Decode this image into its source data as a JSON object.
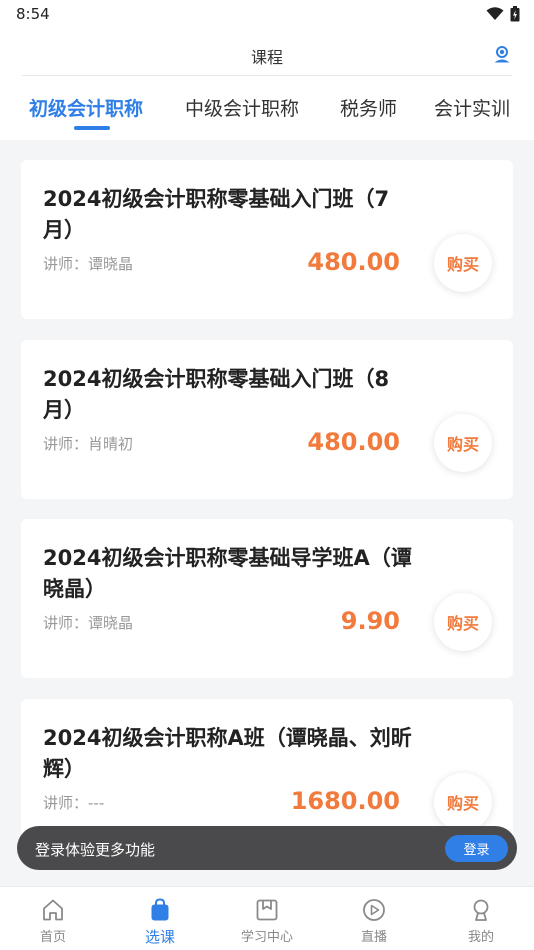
{
  "status_bar": {
    "time": "8:54"
  },
  "header": {
    "title": "课程",
    "service_icon": "customer-service-icon"
  },
  "tabs": [
    {
      "label": "初级会计职称",
      "active": true
    },
    {
      "label": "中级会计职称",
      "active": false
    },
    {
      "label": "税务师",
      "active": false
    },
    {
      "label": "会计实训",
      "active": false
    }
  ],
  "courses": [
    {
      "title": "2024初级会计职称零基础入门班（7月）",
      "teacher": "讲师：谭晓晶",
      "price": "480.00",
      "buy_label": "购买"
    },
    {
      "title": "2024初级会计职称零基础入门班（8月）",
      "teacher": "讲师：肖晴初",
      "price": "480.00",
      "buy_label": "购买"
    },
    {
      "title": "2024初级会计职称零基础导学班A（谭晓晶）",
      "teacher": "讲师：谭晓晶",
      "price": "9.90",
      "buy_label": "购买"
    },
    {
      "title": "2024初级会计职称A班（谭晓晶、刘昕辉）",
      "teacher": "讲师：---",
      "price": "1680.00",
      "buy_label": "购买"
    }
  ],
  "toast": {
    "text": "登录体验更多功能",
    "login_label": "登录"
  },
  "bottom_nav": [
    {
      "label": "首页",
      "icon": "home-icon",
      "active": false
    },
    {
      "label": "选课",
      "icon": "shopping-bag-icon",
      "active": true
    },
    {
      "label": "学习中心",
      "icon": "bookmark-book-icon",
      "active": false
    },
    {
      "label": "直播",
      "icon": "play-circle-icon",
      "active": false
    },
    {
      "label": "我的",
      "icon": "user-icon",
      "active": false
    }
  ],
  "colors": {
    "accent": "#2f7fe6",
    "price": "#f17a3c",
    "background": "#f4f5f7"
  }
}
